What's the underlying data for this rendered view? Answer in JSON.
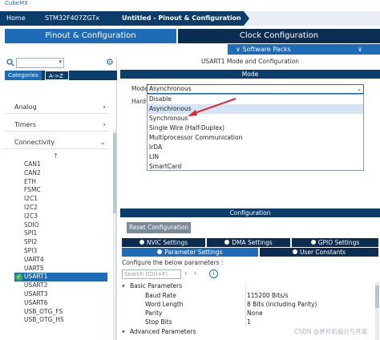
{
  "app": {
    "logo": "CubeMX"
  },
  "breadcrumb": {
    "home": "Home",
    "device": "STM32F407ZGTx",
    "project": "Untitled - Pinout & Configuration"
  },
  "main_tabs": {
    "pinout": "Pinout & Configuration",
    "clock": "Clock Configuration"
  },
  "sub_tabs": {
    "software_packs": "∨ Software Packs",
    "pinout": "∨ Pinout"
  },
  "left": {
    "search_placeholder": "",
    "category_tabs": [
      "Categories",
      "A->Z"
    ],
    "categories": [
      "Analog",
      "Timers",
      "Connectivity"
    ],
    "peripherals": [
      "CAN1",
      "CAN2",
      "ETH",
      "FSMC",
      "I2C1",
      "I2C2",
      "I2C3",
      "SDIO",
      "SPI1",
      "SPI2",
      "SPI3",
      "UART4",
      "UART5",
      "USART1",
      "USART2",
      "USART3",
      "USART6",
      "USB_OTG_FS",
      "USB_OTG_HS"
    ],
    "selected": "USART1"
  },
  "right": {
    "title": "USART1 Mode and Configuration",
    "mode_bar": "Mode",
    "mode_label": "Mode",
    "hw_label": "Hardw",
    "mode_value": "Asynchronous",
    "mode_options": [
      "Disable",
      "Asynchronous",
      "Synchronous",
      "Single Wire (Half-Duplex)",
      "Multiprocessor Communication",
      "IrDA",
      "LIN",
      "SmartCard"
    ],
    "highlighted_option": "Asynchronous",
    "config_bar": "Configuration",
    "reset_button": "Reset Configuration",
    "tabs_row1": [
      "NVIC Settings",
      "DMA Settings",
      "GPIO Settings"
    ],
    "tabs_row2": [
      "Parameter Settings",
      "User Constants"
    ],
    "hint": "Configure the below parameters :",
    "search_placeholder": "Search (Ctrl+F)",
    "groups": {
      "basic": "Basic Parameters",
      "advanced": "Advanced Parameters"
    },
    "params": [
      {
        "name": "Baud Rate",
        "value": "115200 Bits/s"
      },
      {
        "name": "Word Length",
        "value": "8 Bits (including Parity)"
      },
      {
        "name": "Parity",
        "value": "None"
      },
      {
        "name": "Stop Bits",
        "value": "1"
      }
    ]
  },
  "watermark": "CSDN @单片机设计与开发",
  "colors": {
    "navy": "#0b3d6b",
    "blue": "#1e6bb8",
    "dark": "#0b2d52",
    "green": "#3bb54a",
    "arrow": "#e0262a"
  }
}
